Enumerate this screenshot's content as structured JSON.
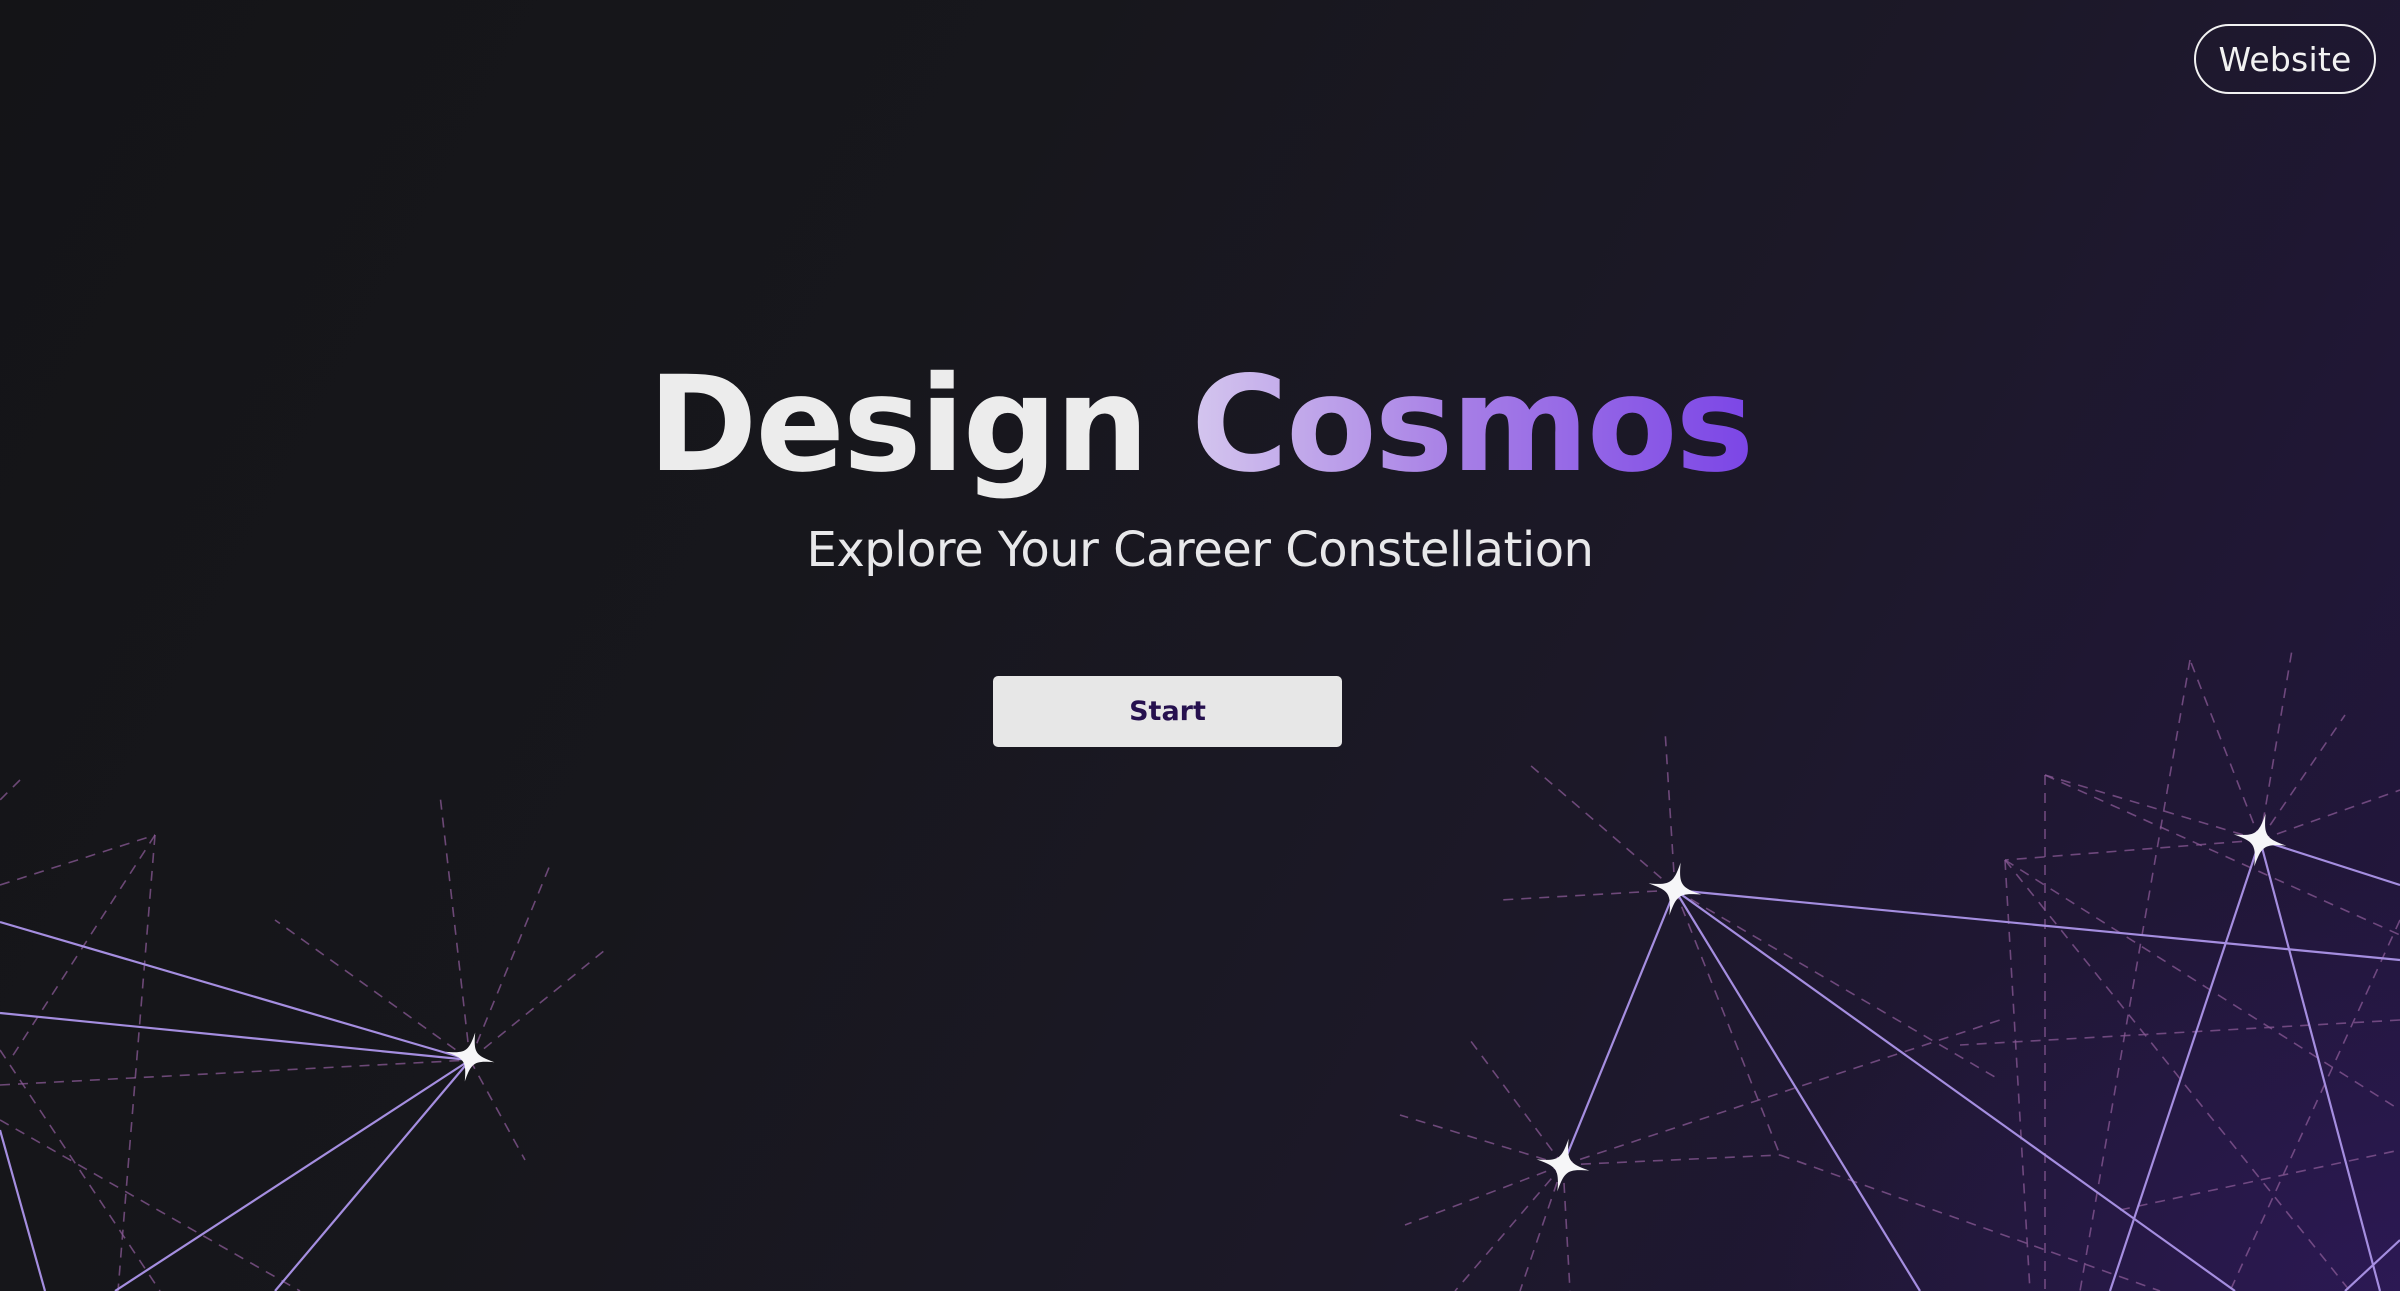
{
  "header": {
    "website_label": "Website"
  },
  "hero": {
    "title_word_1": "Design",
    "title_word_2": "Cosmos",
    "subtitle": "Explore Your Career Constellation",
    "start_label": "Start"
  },
  "colors": {
    "background_dark": "#141417",
    "background_purple": "#231640",
    "title_gradient_start": "#d4c6ee",
    "title_gradient_end": "#7b45e6",
    "constellation_line": "#a58ee0",
    "constellation_dash": "#8a5a96",
    "star": "#ffffff",
    "button_bg": "#e7e7e7",
    "button_text": "#26114f"
  },
  "icons": {
    "star": "four-point-star-icon"
  }
}
